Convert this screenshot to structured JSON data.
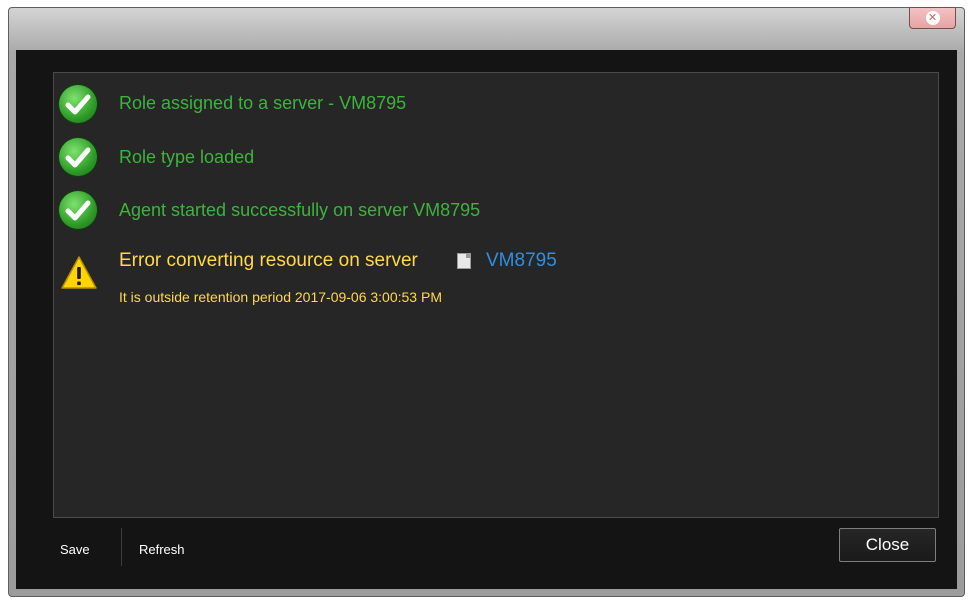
{
  "window": {
    "close_icon": "close-icon"
  },
  "messages": [
    {
      "status": "success",
      "icon": "check-icon",
      "text": "Role assigned to a server - VM8795"
    },
    {
      "status": "success",
      "icon": "check-icon",
      "text": "Role type loaded"
    },
    {
      "status": "success",
      "icon": "check-icon",
      "text": "Agent started successfully on server VM8795"
    }
  ],
  "error": {
    "status": "warning",
    "icon": "warning-icon",
    "text": "Error converting resource on server",
    "server_icon": "document-icon",
    "server": "VM8795",
    "detail": "It is outside retention period 2017-09-06 3:00:53 PM"
  },
  "footer": {
    "save_label": "Save",
    "refresh_label": "Refresh",
    "close_label": "Close"
  },
  "colors": {
    "success": "#3cb43c",
    "warning": "#ffd94a",
    "link": "#2f8fe0",
    "background": "#141414"
  }
}
